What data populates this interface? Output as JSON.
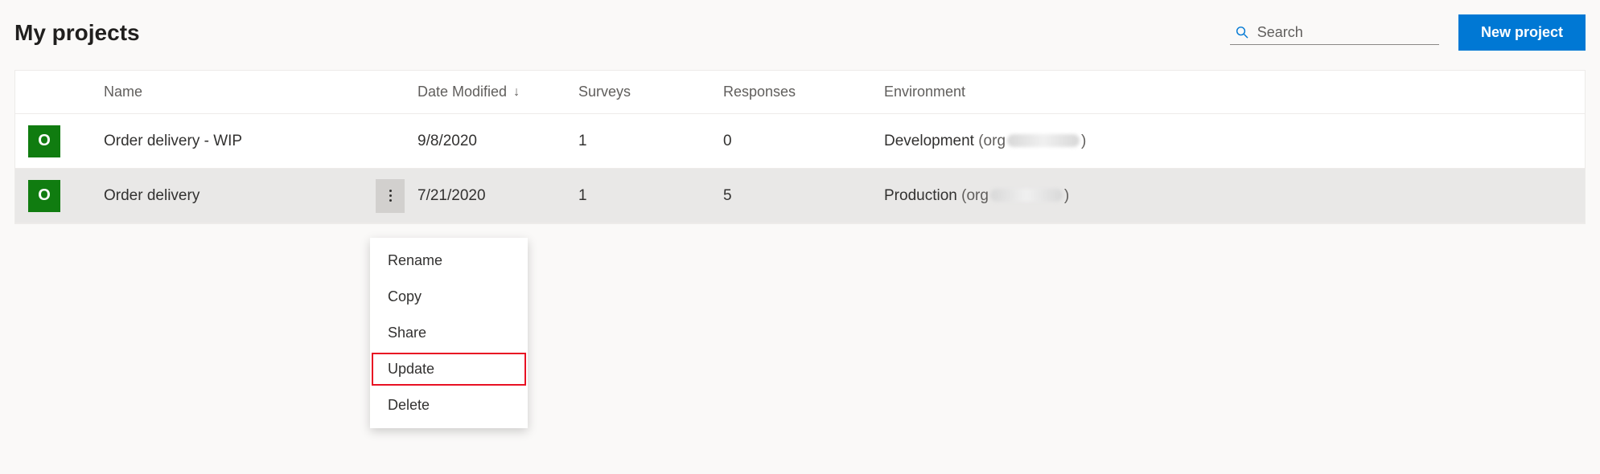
{
  "header": {
    "title": "My projects",
    "search_placeholder": "Search",
    "new_project_label": "New project"
  },
  "columns": {
    "name": "Name",
    "date_modified": "Date Modified",
    "surveys": "Surveys",
    "responses": "Responses",
    "environment": "Environment"
  },
  "rows": [
    {
      "avatar_letter": "O",
      "name": "Order delivery - WIP",
      "date_modified": "9/8/2020",
      "surveys": "1",
      "responses": "0",
      "environment_name": "Development",
      "environment_org_prefix": "(org",
      "environment_org_suffix": ")",
      "selected": false
    },
    {
      "avatar_letter": "O",
      "name": "Order delivery",
      "date_modified": "7/21/2020",
      "surveys": "1",
      "responses": "5",
      "environment_name": "Production",
      "environment_org_prefix": " (org",
      "environment_org_suffix": ")",
      "selected": true
    }
  ],
  "context_menu": {
    "items": [
      {
        "label": "Rename",
        "highlighted": false
      },
      {
        "label": "Copy",
        "highlighted": false
      },
      {
        "label": "Share",
        "highlighted": false
      },
      {
        "label": "Update",
        "highlighted": true
      },
      {
        "label": "Delete",
        "highlighted": false
      }
    ]
  }
}
